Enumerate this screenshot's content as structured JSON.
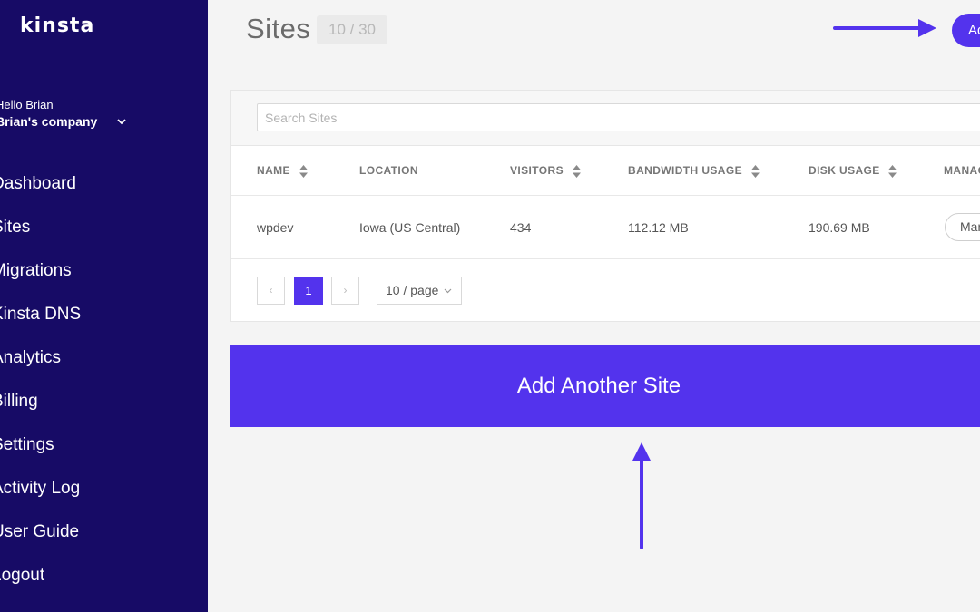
{
  "sidebar": {
    "logo": "kinsta",
    "greeting": "Hello Brian",
    "company": "Brian's company",
    "items": [
      {
        "label": "Dashboard"
      },
      {
        "label": "Sites"
      },
      {
        "label": "Migrations"
      },
      {
        "label": "Kinsta DNS"
      },
      {
        "label": "Analytics"
      },
      {
        "label": "Billing"
      },
      {
        "label": "Settings"
      },
      {
        "label": "Activity Log"
      },
      {
        "label": "User Guide"
      },
      {
        "label": "Logout"
      }
    ]
  },
  "header": {
    "title": "Sites",
    "site_count": "10 / 30",
    "add_button_label": "Add Site"
  },
  "search": {
    "placeholder": "Search Sites"
  },
  "table": {
    "columns": [
      "NAME",
      "LOCATION",
      "VISITORS",
      "BANDWIDTH USAGE",
      "DISK USAGE",
      "MANAGE"
    ],
    "rows": [
      {
        "name": "wpdev",
        "location": "Iowa (US Central)",
        "visitors": "434",
        "bandwidth": "112.12 MB",
        "disk": "190.69 MB",
        "manage_label": "Manage"
      }
    ]
  },
  "pagination": {
    "prev": "‹",
    "current": "1",
    "next": "›",
    "page_size": "10 / page"
  },
  "add_another_label": "Add Another Site",
  "colors": {
    "sidebar": "#170b66",
    "accent": "#5333ed",
    "background": "#f4f4f4"
  }
}
